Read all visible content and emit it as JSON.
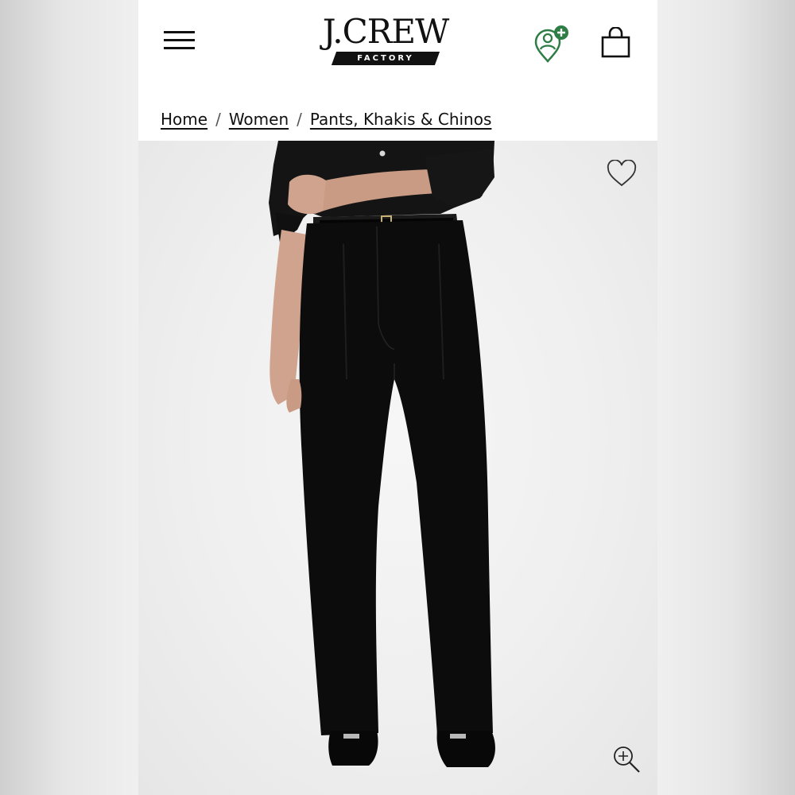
{
  "header": {
    "menu_icon": "hamburger-menu-icon",
    "logo": {
      "wordmark": "J.CREW",
      "tagline": "FACTORY"
    },
    "account_icon": "account-add-icon",
    "bag_icon": "shopping-bag-icon"
  },
  "breadcrumb": {
    "items": [
      "Home",
      "Women",
      "Pants, Khakis & Chinos"
    ],
    "separator": "/"
  },
  "product_image": {
    "wishlist_icon": "heart-outline-icon",
    "zoom_icon": "zoom-in-icon"
  },
  "colors": {
    "accent_green": "#2e7d45",
    "text": "#111111",
    "image_background": "#efefef"
  }
}
